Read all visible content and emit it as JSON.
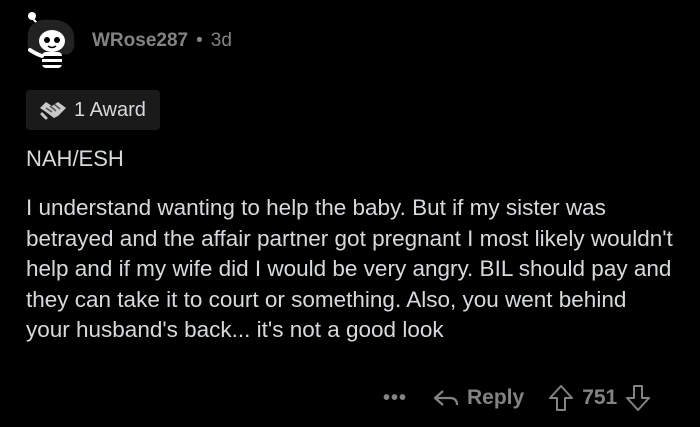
{
  "comment": {
    "username": "WRose287",
    "separator": "•",
    "age": "3d",
    "award_label": "1 Award",
    "verdict": "NAH/ESH",
    "body": "I understand wanting to help the baby. But if my sister was betrayed and the affair partner got pregnant I most likely wouldn't help and if my wife did I would be very angry. BIL should pay and they can take it to court or something. Also, you went behind your husband's back... it's not a good look"
  },
  "actions": {
    "more_label": "•••",
    "reply_label": "Reply",
    "vote_count": "751"
  },
  "icons": {
    "avatar": "snoo-avatar-icon",
    "award": "handshake-award-icon",
    "reply": "reply-arrow-icon",
    "upvote": "upvote-arrow-icon",
    "downvote": "downvote-arrow-icon"
  },
  "colors": {
    "background": "#000000",
    "text": "#d7dadc",
    "muted": "#818384",
    "award_bg": "#1a1a1b"
  }
}
